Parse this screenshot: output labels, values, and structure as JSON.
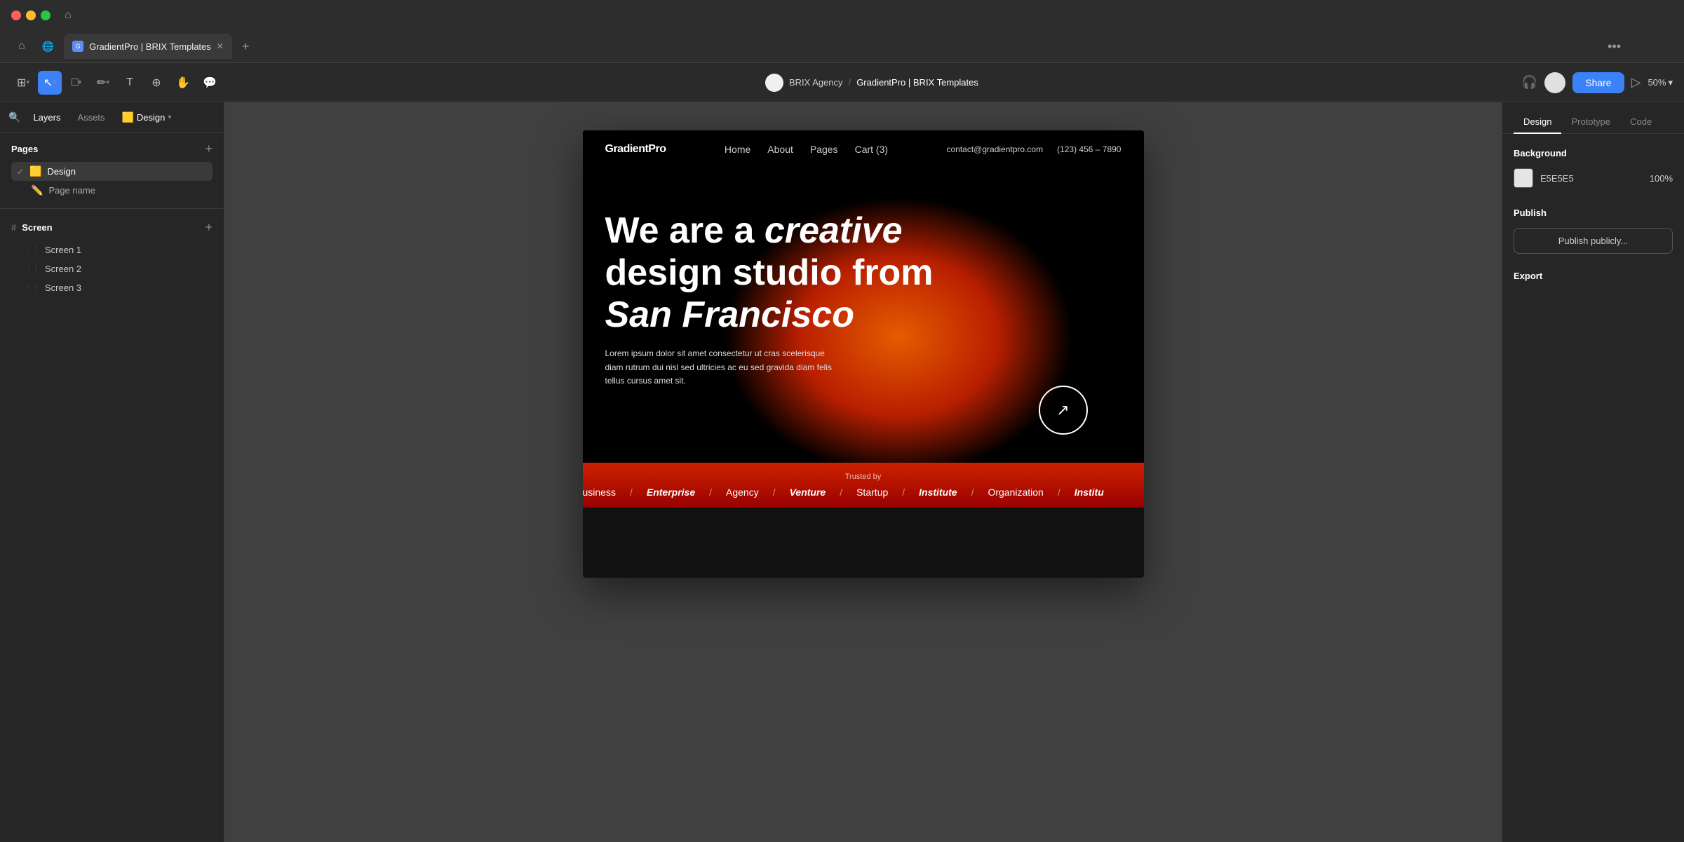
{
  "browser": {
    "tab_label": "GradientPro | BRIX Templates",
    "tab_favicon": "G",
    "more_icon": "•••"
  },
  "toolbar": {
    "workspace_name": "BRIX Agency",
    "project_name": "GradientPro | BRIX Templates",
    "separator": "/",
    "share_label": "Share",
    "zoom_level": "50%",
    "play_icon": "▷"
  },
  "left_panel": {
    "tabs": {
      "layers": "Layers",
      "assets": "Assets",
      "design": "Design"
    },
    "pages_title": "Pages",
    "pages": [
      {
        "name": "Design",
        "emoji": "🟨",
        "active": true
      },
      {
        "name": "Page name",
        "emoji": "✏️",
        "active": false
      }
    ],
    "screen_group": "Screen",
    "layers": [
      {
        "name": "Screen 1"
      },
      {
        "name": "Screen 2"
      },
      {
        "name": "Screen 3"
      }
    ]
  },
  "canvas": {
    "zoom": 0.5
  },
  "website": {
    "logo": "GradientPro",
    "nav_links": [
      "Home",
      "About",
      "Pages",
      "Cart (3)"
    ],
    "contact_email": "contact@gradientpro.com",
    "contact_phone": "(123) 456 – 7890",
    "hero_title_line1": "We are a",
    "hero_title_italic": "creative",
    "hero_title_line2": "design studio from",
    "hero_title_bold": "San Francisco",
    "hero_body": "Lorem ipsum dolor sit amet consectetur ut cras scelerisque diam rutrum dui nisl sed ultricies ac eu sed gravida diam felis tellus cursus amet sit.",
    "trusted_label": "Trusted by",
    "ticker_items": [
      "usiness",
      "Enterprise",
      "Agency",
      "Venture",
      "Startup",
      "Institute",
      "Organization",
      "Institu"
    ]
  },
  "right_panel": {
    "tabs": [
      "Design",
      "Prototype",
      "Code"
    ],
    "active_tab": "Design",
    "background_title": "Background",
    "bg_color": "E5E5E5",
    "bg_opacity": "100%",
    "publish_title": "Publish",
    "publish_btn_label": "Publish publicly...",
    "export_title": "Export"
  }
}
